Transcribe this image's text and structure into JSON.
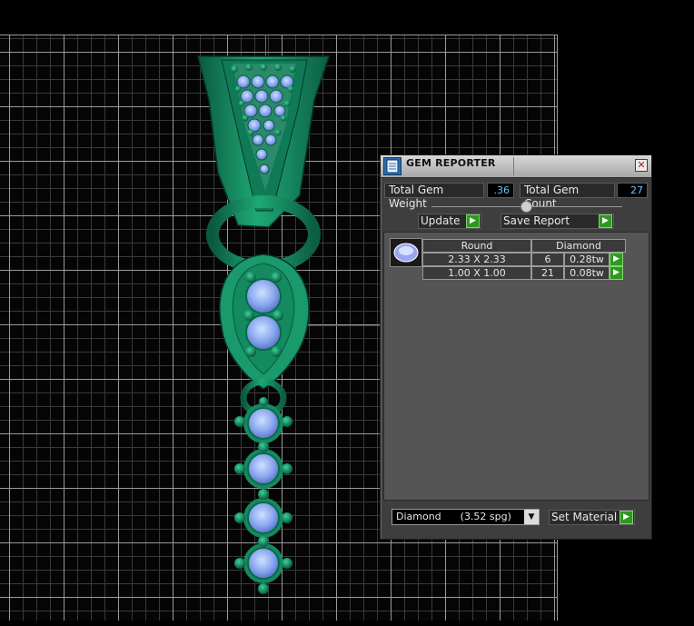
{
  "panel": {
    "title": "GEM REPORTER",
    "close_glyph": "✕",
    "total_gem_weight_label": "Total Gem Weight",
    "total_gem_weight_value": ".36",
    "total_gem_count_label": "Total Gem Count",
    "total_gem_count_value": "27",
    "slider_level": 0.5,
    "update_label": "Update",
    "save_report_label": "Save Report",
    "go_glyph": "▶"
  },
  "report": {
    "headers": [
      "Round",
      "Diamond"
    ],
    "rows": [
      {
        "size": "2.33 X 2.33",
        "count": "6",
        "weight": "0.28tw"
      },
      {
        "size": "1.00 X 1.00",
        "count": "21",
        "weight": "0.08tw"
      }
    ]
  },
  "material": {
    "selected": "Diamond      (3.52 spg)",
    "set_label": "Set Material",
    "arrow_glyph": "▼"
  },
  "icons": {
    "title_icon": "gem-reporter-icon",
    "thumb_icon": "round-gem-icon"
  },
  "colors": {
    "metal": "#138a62",
    "metal_dark": "#0b5a3e",
    "gem": "#8ab0f0",
    "value_text": "#6fc3ff",
    "go_button": "#2d9a1e"
  }
}
